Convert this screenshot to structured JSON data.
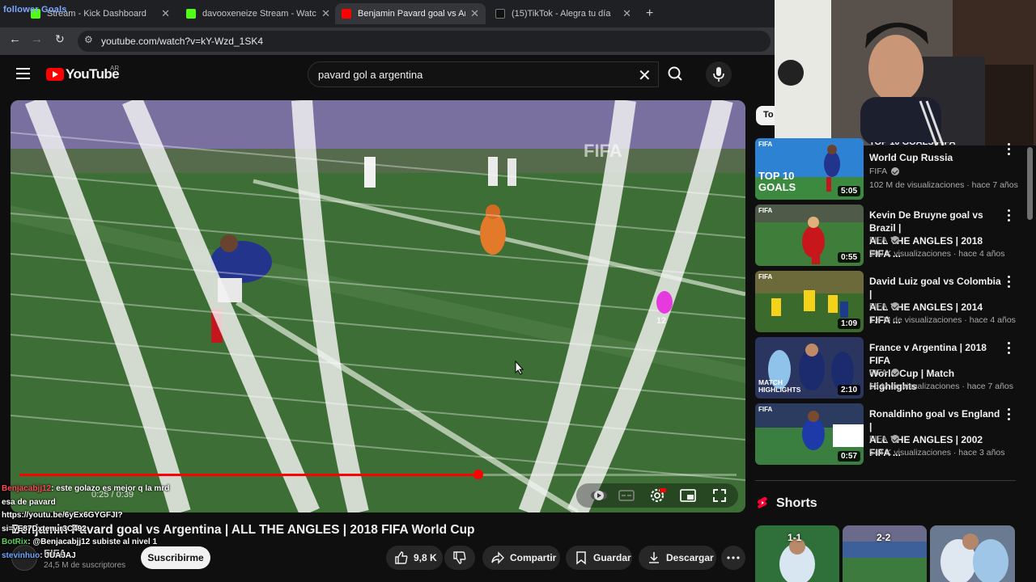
{
  "browser": {
    "overlay_follow_text": "follower Goals",
    "tabs": [
      {
        "label": "Stream - Kick Dashboard",
        "favicon_color": "#53fc18"
      },
      {
        "label": "davooxeneize Stream - Watch Live",
        "favicon_color": "#53fc18"
      },
      {
        "label": "Benjamin Pavard goal vs Argentina",
        "favicon_color": "#ff0000"
      },
      {
        "label": "(15)TikTok - Alegra tu día",
        "favicon_color": "#ffffff"
      }
    ],
    "address": "youtube.com/watch?v=kY-Wzd_1SK4"
  },
  "youtube": {
    "logo_text": "YouTube",
    "region": "AR",
    "search_query": "pavard gol a argentina"
  },
  "player": {
    "time_display": "0:25 / 0:39",
    "progress": 0.64,
    "overlay_brand": "FIFA",
    "jersey_number": "12"
  },
  "video": {
    "title": "Benjamin Pavard goal vs Argentina | ALL THE ANGLES | 2018 FIFA World Cup",
    "channel": "FIFA",
    "subscribers": "24,5 M de suscriptores",
    "subscribe_label": "Suscribirme",
    "likes": "9,8 K",
    "share_label": "Compartir",
    "save_label": "Guardar",
    "download_label": "Descargar"
  },
  "chat": [
    {
      "user": "Benjacabjj12",
      "text": ": este golazo es mejor q la mrd esa de pavard https://youtu.be/6yEx6GYGFJI?si=yE87Dxtenur3C492"
    },
    {
      "user": "BotRix",
      "text": ": @Benjacabjj12 subiste al nivel 1"
    },
    {
      "user": "stevinhuo",
      "text": ": JUAJAJ"
    }
  ],
  "sidebar": {
    "chip_label": "To",
    "recommendations": [
      {
        "title_line1": "TOP 10 GOALS FIFA",
        "title_line2": "World Cup Russia",
        "channel": "FIFA",
        "meta": "102 M de visualizaciones · hace 7 años",
        "duration": "5:05",
        "thumb_text": "TOP 10 GOALS",
        "thumb_color": "#2d7fd0"
      },
      {
        "title_line1": "Kevin De Bruyne goal vs Brazil |",
        "title_line2": "ALL THE ANGLES | 2018 FIFA ...",
        "channel": "FIFA",
        "meta": "290 K visualizaciones · hace 4 años",
        "duration": "0:55",
        "thumb_text": "FIFA",
        "thumb_color": "#3b7a3a"
      },
      {
        "title_line1": "David Luiz goal vs Colombia |",
        "title_line2": "ALL THE ANGLES | 2014 FIFA ...",
        "channel": "FIFA",
        "meta": "1,4 M de visualizaciones · hace 4 años",
        "duration": "1:09",
        "thumb_text": "FIFA",
        "thumb_color": "#3a6a2c"
      },
      {
        "title_line1": "France v Argentina | 2018 FIFA",
        "title_line2": "World Cup | Match Highlights",
        "channel": "FIFA",
        "meta": "65 M de visualizaciones · hace 7 años",
        "duration": "2:10",
        "thumb_text": "MATCH HIGHLIGHTS",
        "thumb_color": "#24306a"
      },
      {
        "title_line1": "Ronaldinho goal vs England |",
        "title_line2": "ALL THE ANGLES | 2002 FIFA ...",
        "channel": "FIFA",
        "meta": "544 K visualizaciones · hace 3 años",
        "duration": "0:57",
        "thumb_text": "FIFA",
        "thumb_color": "#3a7f40"
      }
    ],
    "shorts_title": "Shorts",
    "shorts": [
      {
        "score": "1-1",
        "color": "#2f6f3a"
      },
      {
        "score": "2-2",
        "color": "#3d5f9a"
      },
      {
        "score": "",
        "color": "#6a7a90"
      }
    ]
  }
}
